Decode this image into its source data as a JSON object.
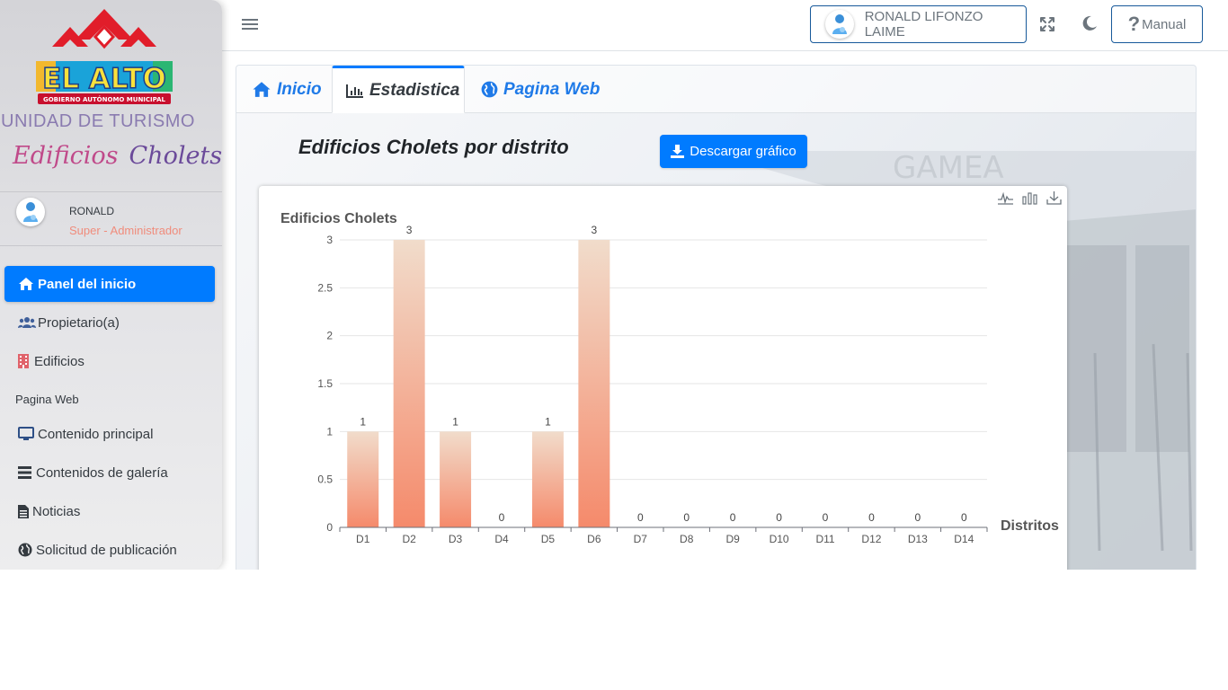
{
  "sidebar": {
    "logo_text": "EL ALTO",
    "logo_subtext": "GOBIERNO AUTÓNOMO MUNICIPAL",
    "unidad": "UNIDAD DE TURISMO",
    "script_word1": "Edificios",
    "script_word2": "Cholets",
    "user_name": "RONALD",
    "user_role": "Super - Administrador",
    "items": [
      {
        "label": "Panel del inicio",
        "icon": "home-icon"
      },
      {
        "label": "Propietario(a)",
        "icon": "users-icon"
      },
      {
        "label": "Edificios",
        "icon": "building-icon"
      }
    ],
    "section_header": "Pagina Web",
    "web_items": [
      {
        "label": "Contenido principal",
        "icon": "monitor-icon"
      },
      {
        "label": "Contenidos de galería",
        "icon": "list-icon"
      },
      {
        "label": "Noticias",
        "icon": "document-icon"
      },
      {
        "label": "Solicitud de publicación",
        "icon": "globe-icon"
      }
    ]
  },
  "topbar": {
    "user_button": "RONALD LIFONZO LAIME",
    "manual_button": "Manual"
  },
  "tabs": [
    {
      "label": "Inicio",
      "icon": "home-icon"
    },
    {
      "label": "Estadistica",
      "icon": "bar-chart-icon"
    },
    {
      "label": "Pagina Web",
      "icon": "globe-icon"
    }
  ],
  "main": {
    "title": "Edificios Cholets por distrito",
    "download_button": "Descargar gráfico",
    "bg_sign_text": "GAMEA"
  },
  "colors": {
    "primary": "#007bff",
    "bar_top": "#f1dccb",
    "bar_bottom": "#f58a6b"
  },
  "chart_data": {
    "type": "bar",
    "title": "Edificios Cholets",
    "xlabel": "Distritos",
    "ylabel": "",
    "categories": [
      "D1",
      "D2",
      "D3",
      "D4",
      "D5",
      "D6",
      "D7",
      "D8",
      "D9",
      "D10",
      "D11",
      "D12",
      "D13",
      "D14"
    ],
    "values": [
      1,
      3,
      1,
      0,
      1,
      3,
      0,
      0,
      0,
      0,
      0,
      0,
      0,
      0
    ],
    "ylim": [
      0,
      3
    ],
    "yticks": [
      0,
      0.5,
      1,
      1.5,
      2,
      2.5,
      3
    ],
    "grid": true,
    "data_labels": true
  }
}
